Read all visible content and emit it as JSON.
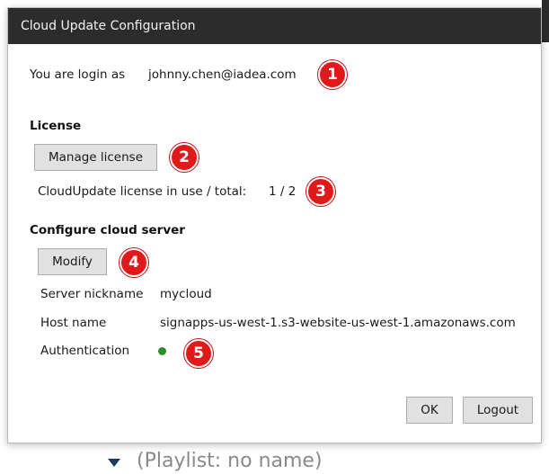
{
  "window": {
    "title": "Cloud Update Configuration"
  },
  "login": {
    "label": "You are login as",
    "email": "johnny.chen@iadea.com"
  },
  "license": {
    "heading": "License",
    "manage_button": "Manage license",
    "usage_label": "CloudUpdate license in use / total:",
    "usage_value": "1 / 2"
  },
  "cloud_server": {
    "heading": "Configure cloud server",
    "modify_button": "Modify",
    "fields": [
      {
        "label": "Server nickname",
        "value": "mycloud"
      },
      {
        "label": "Host name",
        "value": "signapps-us-west-1.s3-website-us-west-1.amazonaws.com"
      },
      {
        "label": "Authentication",
        "value": ""
      }
    ],
    "auth_status_color": "#2a8c2a"
  },
  "actions": {
    "ok_button": "OK",
    "logout_button": "Logout"
  },
  "callouts": [
    "1",
    "2",
    "3",
    "4",
    "5"
  ],
  "background": {
    "playlist_text": "(Playlist: no name)",
    "chevron_icon": "chevron-down-icon"
  },
  "colors": {
    "titlebar": "#2c2c2c",
    "callout": "#e0191b",
    "button_face": "#e1e1e1"
  }
}
